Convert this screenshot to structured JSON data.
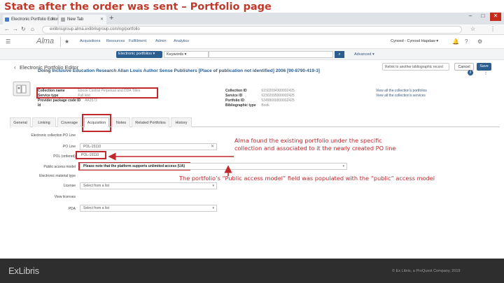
{
  "slide": {
    "title": "State after the order was sent – Portfolio page"
  },
  "browser": {
    "tabs": [
      {
        "label": "Electronic Portfolio Editor"
      },
      {
        "label": "New Tab"
      }
    ],
    "url": "exlibrisgroup.alma.exlibrisgroup.com/ng/portfolio",
    "new_tab_glyph": "+"
  },
  "alma": {
    "logo": "Alma",
    "menu": [
      "Acquisitions",
      "Resources",
      "Fulfillment",
      "Admin",
      "Analytics"
    ],
    "user": "Cynosd - Cynosd Hapdaw ▾"
  },
  "search": {
    "type_label": "Electronic portfolios ▾",
    "field_label": "Keywords ▾",
    "advanced_label": "Advanced ▾"
  },
  "page": {
    "title": "Electronic Portfolio Editor",
    "relink_label": "Relink to another bibliographic record",
    "cancel_label": "Cancel",
    "save_label": "Save"
  },
  "record": {
    "title": "Doing Inclusive Education Research Allan Louis Author Sense Publishers [Place of publication not identified] 2006 [90-8790-419-3]",
    "left_fields": [
      {
        "key": "Collection name",
        "value": "Ebook Central Perpetual and DDA Titles"
      },
      {
        "key": "Service type",
        "value": "Full text"
      },
      {
        "key": "Provider package code ID",
        "value": "AA3572"
      },
      {
        "key": "Id",
        "value": ""
      }
    ],
    "mid_fields": [
      {
        "key": "Collection ID",
        "value": "61502094300002425"
      },
      {
        "key": "Service ID",
        "value": "62302095000002425"
      },
      {
        "key": "Portfolio ID",
        "value": "53499000000002425"
      },
      {
        "key": "Bibliographic type",
        "value": "Book"
      }
    ],
    "right_links": [
      "View all the collection's portfolios",
      "View all the collection's services"
    ]
  },
  "editor_tabs": [
    "General",
    "Linking",
    "Coverage",
    "Acquisition",
    "Notes",
    "Related Portfolios",
    "History"
  ],
  "form": {
    "rows": [
      {
        "label": "Electronic collection PO Line",
        "value": ""
      },
      {
        "label": "PO Line",
        "value": "POL-15110"
      },
      {
        "label": "POL (ordered)",
        "value": "POL-15110"
      },
      {
        "label": "Public access model",
        "value": "Please note that the platform supports unlimited access (UA)"
      },
      {
        "label": "Electronic material type",
        "value": ""
      },
      {
        "label": "License",
        "value": "Select from a list"
      },
      {
        "label": "View licenses",
        "value": ""
      },
      {
        "label": "PDA",
        "value": "Select from a list"
      }
    ]
  },
  "callouts": {
    "portfolio_note": "Alma found the existing portfolio under the specific\ncollection and associated to it the newly created PO line",
    "access_model_note": "The portfolio’s “Public access model” field was populated with the “public” access model"
  },
  "footer": {
    "logo_ex": "Ex",
    "logo_libris": "Libris",
    "copyright": "© Ex Libris, a ProQuest Company, 2019"
  },
  "colors": {
    "annotation_red": "#c0282d",
    "alma_blue": "#2b5d8f",
    "footer_bg": "#2e2e2e"
  }
}
